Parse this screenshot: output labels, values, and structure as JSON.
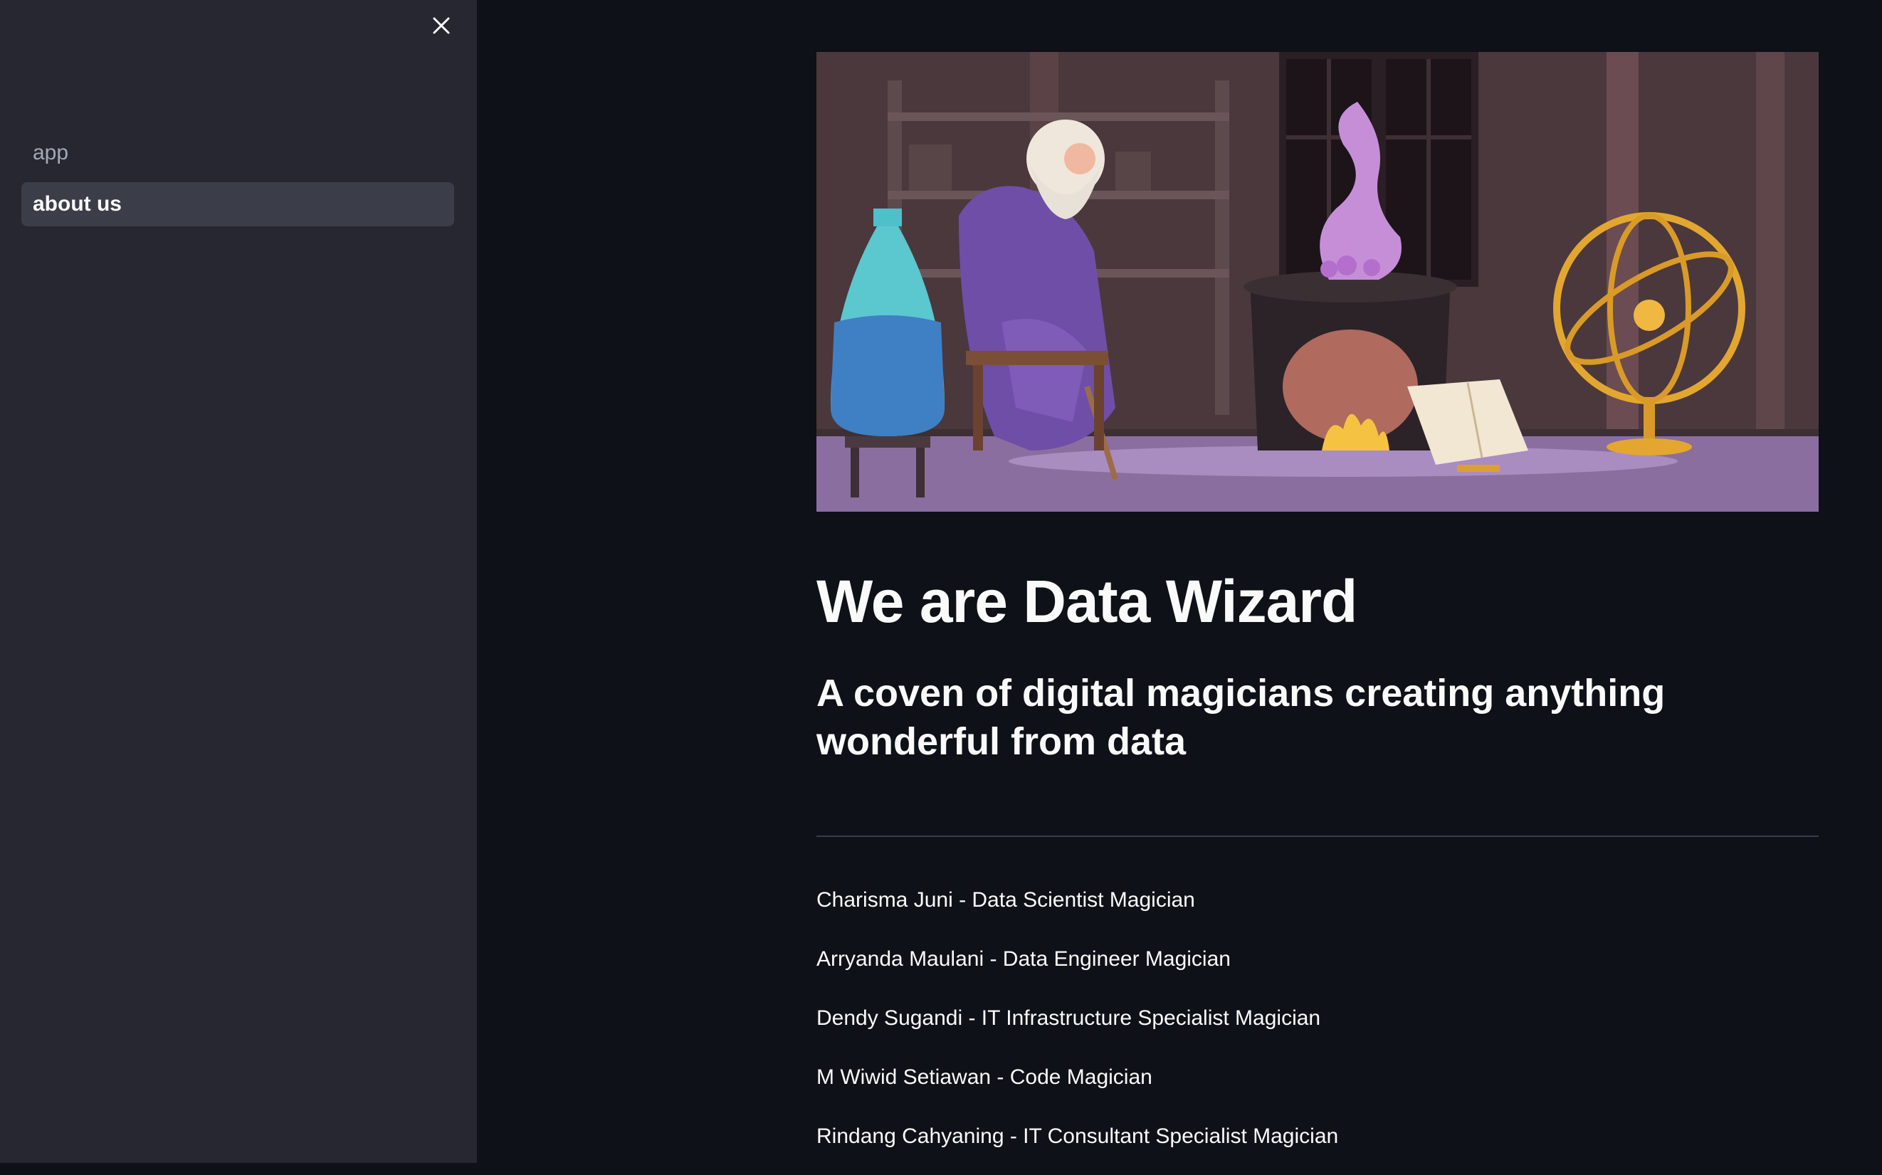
{
  "sidebar": {
    "close_icon": "close-icon",
    "nav": [
      {
        "label": "app",
        "active": false
      },
      {
        "label": "about us",
        "active": true
      }
    ]
  },
  "main": {
    "hero_image": "wizard-laboratory-illustration",
    "title": "We are Data Wizard",
    "subtitle": "A coven of digital magicians creating anything wonderful from data",
    "members": [
      "Charisma Juni - Data Scientist Magician",
      "Arryanda Maulani - Data Engineer Magician",
      "Dendy Sugandi - IT Infrastructure Specialist Magician",
      "M Wiwid Setiawan - Code Magician",
      "Rindang Cahyaning - IT Consultant Specialist Magician"
    ]
  },
  "colors": {
    "app_bg": "#0e1117",
    "sidebar_bg": "#262730",
    "nav_active_bg": "#3b3d49",
    "text": "#fafafa",
    "muted_text": "#a3a8b8"
  }
}
